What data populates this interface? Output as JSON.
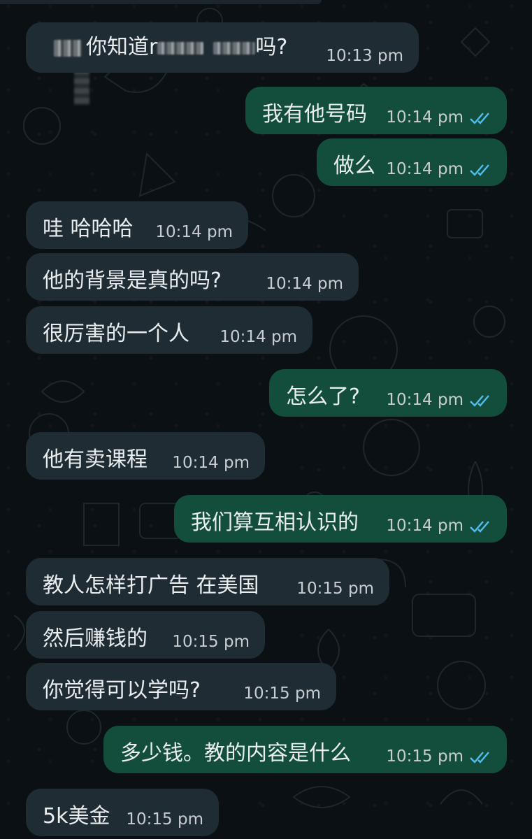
{
  "messages": [
    {
      "id": "m1",
      "dir": "in",
      "text_before": "",
      "text_mid": "你知道r",
      "text_after": "吗?",
      "time": "10:13 pm"
    },
    {
      "id": "m2",
      "dir": "out",
      "text": "我有他号码",
      "time": "10:14 pm"
    },
    {
      "id": "m3",
      "dir": "out",
      "text": "做么",
      "time": "10:14 pm"
    },
    {
      "id": "m4",
      "dir": "in",
      "text": "哇 哈哈哈",
      "time": "10:14 pm"
    },
    {
      "id": "m5",
      "dir": "in",
      "text": "他的背景是真的吗?",
      "time": "10:14 pm"
    },
    {
      "id": "m6",
      "dir": "in",
      "text": "很厉害的一个人",
      "time": "10:14 pm"
    },
    {
      "id": "m7",
      "dir": "out",
      "text": "怎么了?",
      "time": "10:14 pm"
    },
    {
      "id": "m8",
      "dir": "in",
      "text": "他有卖课程",
      "time": "10:14 pm"
    },
    {
      "id": "m9",
      "dir": "out",
      "text": "我们算互相认识的",
      "time": "10:14 pm"
    },
    {
      "id": "m10",
      "dir": "in",
      "text": "教人怎样打广告 在美国",
      "time": "10:15 pm"
    },
    {
      "id": "m11",
      "dir": "in",
      "text": "然后赚钱的",
      "time": "10:15 pm"
    },
    {
      "id": "m12",
      "dir": "in",
      "text": "你觉得可以学吗?",
      "time": "10:15 pm"
    },
    {
      "id": "m13",
      "dir": "out",
      "text": "多少钱。教的内容是什么",
      "time": "10:15 pm"
    },
    {
      "id": "m14",
      "dir": "in",
      "text": "5k美金",
      "time": "10:15 pm"
    }
  ],
  "colors": {
    "background": "#0b1014",
    "incoming_bubble": "#202c33",
    "outgoing_bubble": "#134e3d",
    "text": "#e9edef",
    "timestamp": "#c7cdd0",
    "read_ticks": "#53bdeb"
  },
  "icons": {
    "read_receipt": "double-check-icon",
    "wallpaper": "doodle-pattern"
  }
}
